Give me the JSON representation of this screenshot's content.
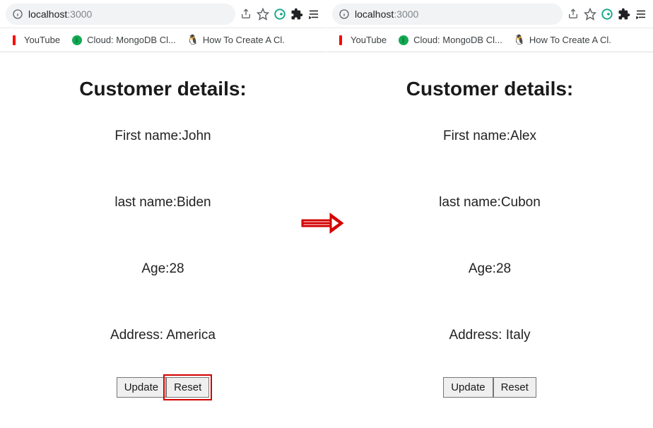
{
  "browser": {
    "url_host": "localhost",
    "url_port": ":3000",
    "bookmarks": [
      {
        "label": "YouTube"
      },
      {
        "label": "Cloud: MongoDB Cl..."
      },
      {
        "label": "How To Create A Cl."
      }
    ]
  },
  "left": {
    "title": "Customer details:",
    "first_name_label": "First name:",
    "first_name_value": "John",
    "last_name_label": "last name:",
    "last_name_value": "Biden",
    "age_label": "Age:",
    "age_value": "28",
    "address_label": "Address:",
    "address_value": " America",
    "update_btn": "Update",
    "reset_btn": "Reset"
  },
  "right": {
    "title": "Customer details:",
    "first_name_label": "First name:",
    "first_name_value": "Alex",
    "last_name_label": "last name:",
    "last_name_value": "Cubon",
    "age_label": "Age:",
    "age_value": "28",
    "address_label": "Address:",
    "address_value": " Italy",
    "update_btn": "Update",
    "reset_btn": "Reset"
  }
}
